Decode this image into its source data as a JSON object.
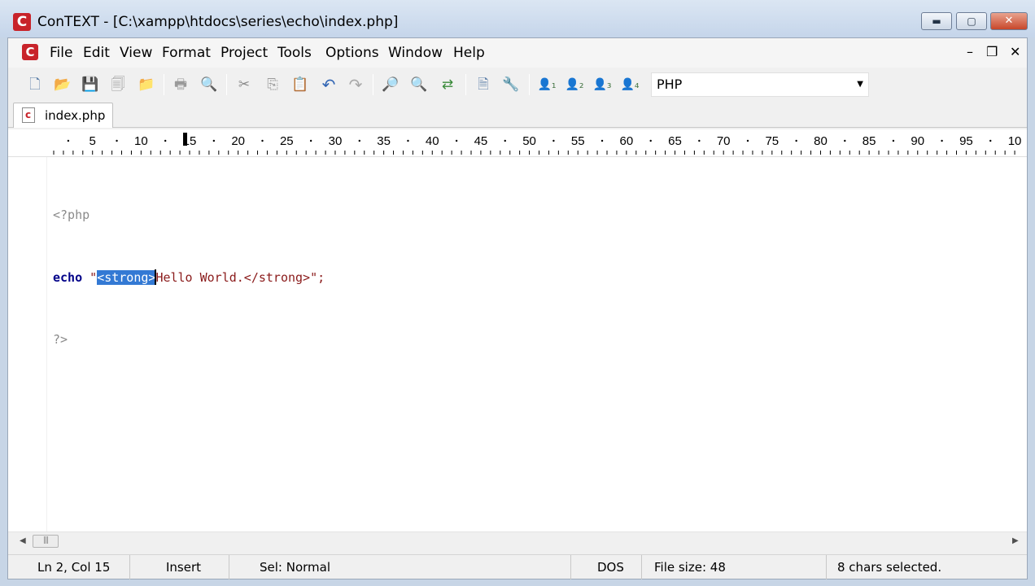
{
  "window": {
    "title": "ConTEXT - [C:\\xampp\\htdocs\\series\\echo\\index.php]",
    "logo_letter": "C",
    "minimize_glyph": "▬",
    "maximize_glyph": "▢",
    "close_glyph": "✕"
  },
  "menubar": {
    "items": [
      "File",
      "Edit",
      "View",
      "Format",
      "Project",
      "Tools",
      "Options",
      "Window",
      "Help"
    ],
    "mdi_controls": [
      "–",
      "❐",
      "✕"
    ]
  },
  "toolbar": {
    "buttons": [
      {
        "name": "new-file",
        "glyph": "🗋"
      },
      {
        "name": "open-file",
        "glyph": "📂"
      },
      {
        "name": "save",
        "glyph": "💾"
      },
      {
        "name": "save-all",
        "glyph": "🗐"
      },
      {
        "name": "open-folder",
        "glyph": "📁"
      },
      {
        "name": "print",
        "glyph": "🖶"
      },
      {
        "name": "print-preview",
        "glyph": "🔍"
      },
      {
        "name": "cut",
        "glyph": "✂"
      },
      {
        "name": "copy",
        "glyph": "⎘"
      },
      {
        "name": "paste",
        "glyph": "📋"
      },
      {
        "name": "undo",
        "glyph": "↶"
      },
      {
        "name": "redo",
        "glyph": "↷"
      },
      {
        "name": "find",
        "glyph": "🔎"
      },
      {
        "name": "find-next",
        "glyph": "🔍"
      },
      {
        "name": "replace",
        "glyph": "⇄"
      },
      {
        "name": "file-properties",
        "glyph": "🗎"
      },
      {
        "name": "tools-config",
        "glyph": "🔧"
      },
      {
        "name": "user-exec-1",
        "glyph": "👤₁"
      },
      {
        "name": "user-exec-2",
        "glyph": "👤₂"
      },
      {
        "name": "user-exec-3",
        "glyph": "👤₃"
      },
      {
        "name": "user-exec-4",
        "glyph": "👤₄"
      }
    ],
    "highlighter": "PHP",
    "dropdown_arrow": "▼"
  },
  "tabs": [
    {
      "label": "index.php"
    }
  ],
  "ruler": {
    "labels": [
      "5",
      "10",
      "15",
      "20",
      "25",
      "30",
      "35",
      "40",
      "45",
      "50",
      "55",
      "60",
      "65",
      "70",
      "75",
      "80",
      "85",
      "90",
      "95",
      "10"
    ],
    "cursor_column": 15
  },
  "editor": {
    "line1": "<?php",
    "line2_kw": "echo",
    "line2_space": " ",
    "line2_quote": "\"",
    "line2_selected": "<strong>",
    "line2_rest": "Hello World.</strong>\";",
    "line3": "?>"
  },
  "scrollbar": {
    "left_arrow": "◀",
    "right_arrow": "▶",
    "thumb_grip": "|||"
  },
  "statusbar": {
    "position": "Ln 2, Col 15",
    "mode": "Insert",
    "selection_mode": "Sel: Normal",
    "line_ending": "DOS",
    "file_size": "File size: 48",
    "selection_info": "8 chars selected."
  }
}
